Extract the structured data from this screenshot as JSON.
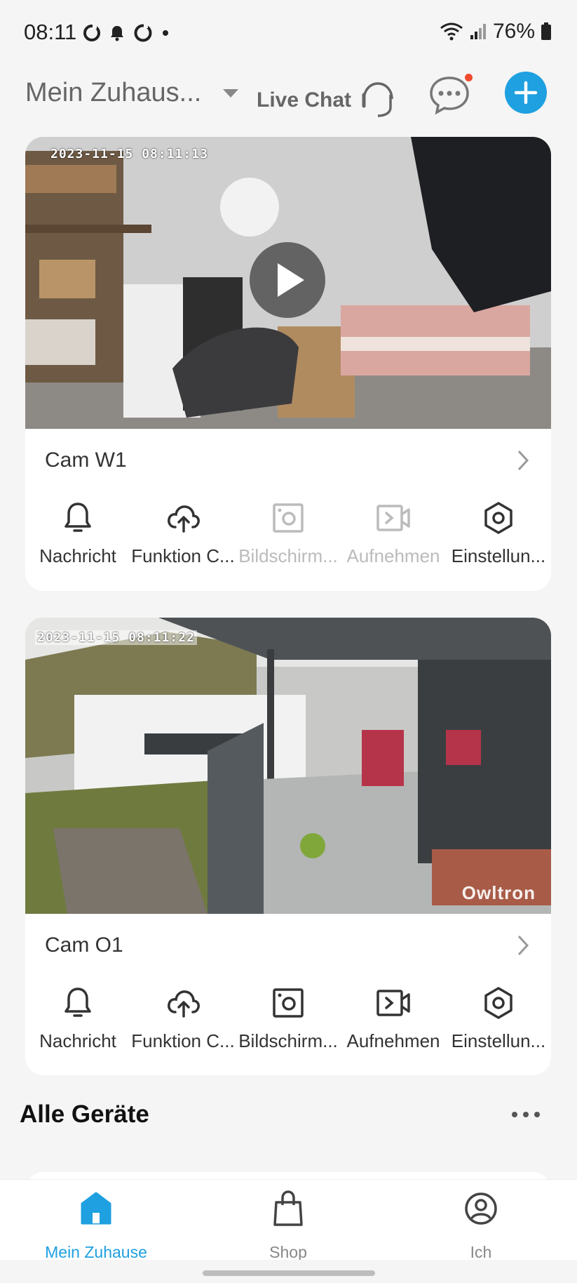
{
  "status_bar": {
    "time": "08:11",
    "battery": "76%"
  },
  "header": {
    "home_title": "Mein Zuhaus...",
    "live_chat": "Live Chat"
  },
  "cameras": [
    {
      "name": "Cam W1",
      "timestamp": "2023-11-15 08:11:13",
      "watermark": "",
      "actions": [
        {
          "label": "Nachricht",
          "icon": "bell-icon",
          "enabled": true
        },
        {
          "label": "Funktion C...",
          "icon": "cloud-upload-icon",
          "enabled": true
        },
        {
          "label": "Bildschirm...",
          "icon": "screenshot-icon",
          "enabled": false
        },
        {
          "label": "Aufnehmen",
          "icon": "record-video-icon",
          "enabled": false
        },
        {
          "label": "Einstellun...",
          "icon": "settings-icon",
          "enabled": true
        }
      ]
    },
    {
      "name": "Cam O1",
      "timestamp": "2023-11-15 08:11:22",
      "watermark": "Owltron",
      "actions": [
        {
          "label": "Nachricht",
          "icon": "bell-icon",
          "enabled": true
        },
        {
          "label": "Funktion C...",
          "icon": "cloud-upload-icon",
          "enabled": true
        },
        {
          "label": "Bildschirm...",
          "icon": "screenshot-icon",
          "enabled": true
        },
        {
          "label": "Aufnehmen",
          "icon": "record-video-icon",
          "enabled": true
        },
        {
          "label": "Einstellun...",
          "icon": "settings-icon",
          "enabled": true
        }
      ]
    }
  ],
  "section": {
    "title": "Alle Geräte"
  },
  "bottom_nav": [
    {
      "label": "Mein Zuhause",
      "icon": "home-icon",
      "active": true
    },
    {
      "label": "Shop",
      "icon": "shopping-bag-icon",
      "active": false
    },
    {
      "label": "Ich",
      "icon": "profile-icon",
      "active": false
    }
  ],
  "colors": {
    "accent": "#1fa0e0",
    "notification": "#f04a2e",
    "disabled": "#bbbbbb"
  }
}
